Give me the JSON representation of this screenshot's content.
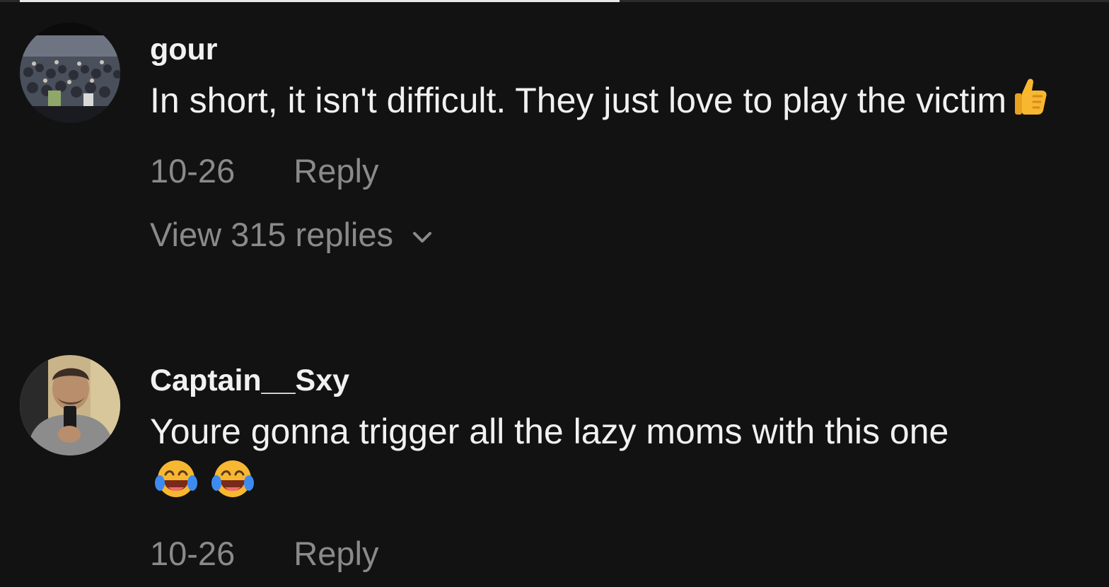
{
  "comments": [
    {
      "username": "gour",
      "text": "In short, it isn't difficult. They just love to play the victim",
      "emoji": [
        "thumbs-up-icon"
      ],
      "date": "10-26",
      "reply_label": "Reply",
      "view_replies_label": "View 315 replies"
    },
    {
      "username": "Captain__Sxy",
      "text": "Youre gonna trigger all the lazy moms with this one",
      "emoji": [
        "laughing-tears-icon",
        "laughing-tears-icon"
      ],
      "date": "10-26",
      "reply_label": "Reply"
    }
  ],
  "colors": {
    "background": "#121212",
    "primary_text": "#f1f1f1",
    "secondary_text": "#8a8a8a"
  }
}
